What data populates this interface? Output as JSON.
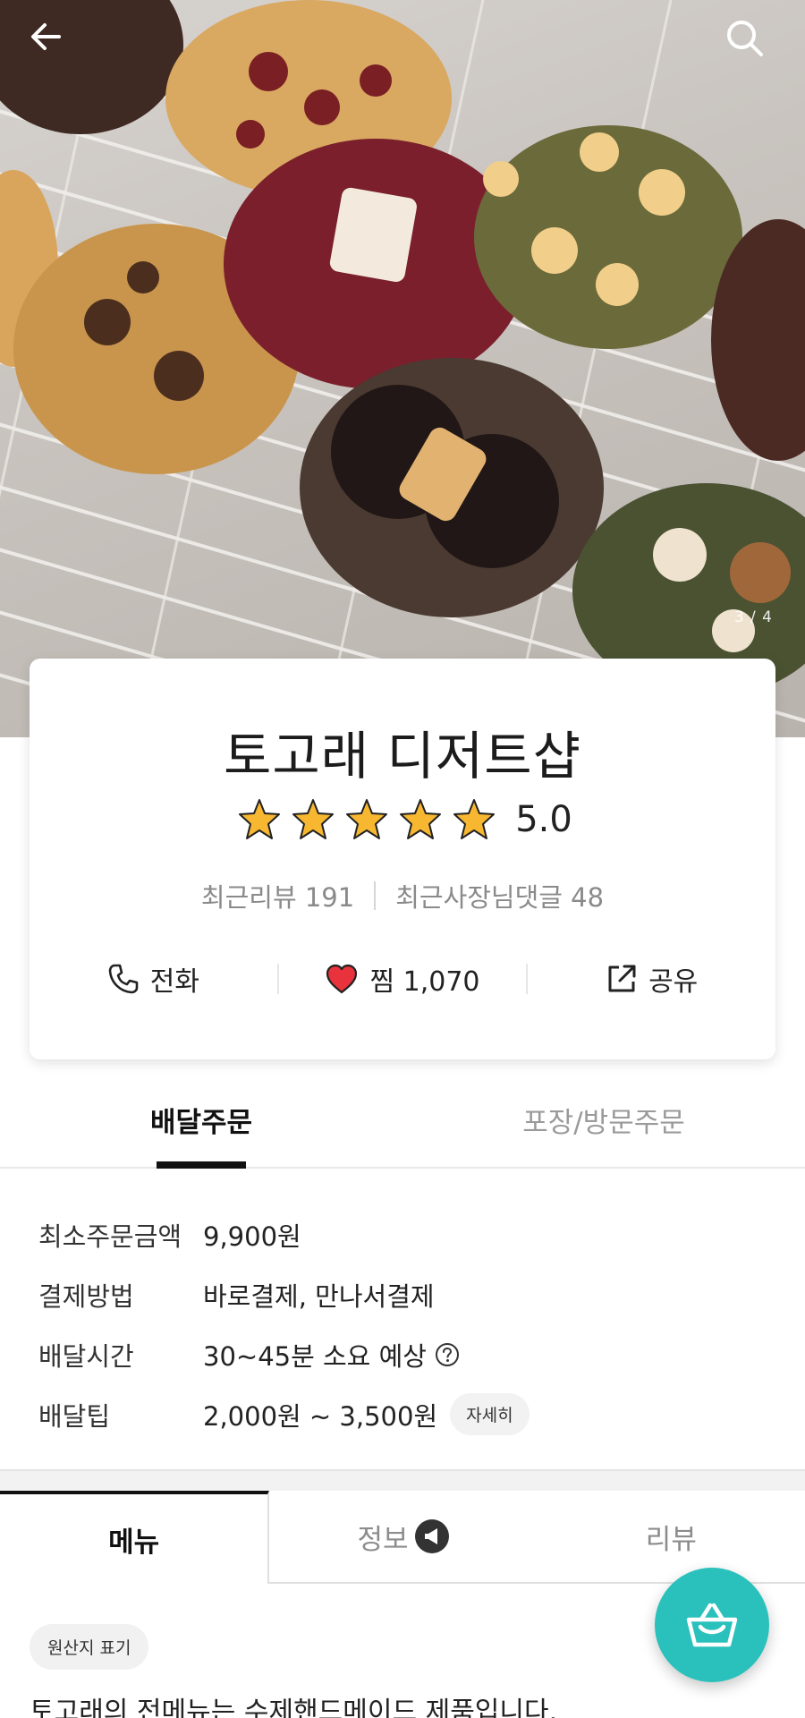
{
  "hero": {
    "image_counter": "3 / 4",
    "back_icon": "back-arrow-icon",
    "search_icon": "search-icon"
  },
  "store": {
    "name": "토고래 디저트샵",
    "rating": "5.0",
    "stars": 5,
    "recent_reviews": "최근리뷰 191",
    "owner_replies": "최근사장님댓글 48",
    "actions": {
      "call": "전화",
      "like": "찜 1,070",
      "share": "공유"
    }
  },
  "order_tabs": {
    "delivery": "배달주문",
    "pickup": "포장/방문주문"
  },
  "info": {
    "min_order_label": "최소주문금액",
    "min_order_value": "9,900원",
    "payment_label": "결제방법",
    "payment_value": "바로결제, 만나서결제",
    "time_label": "배달시간",
    "time_value": "30~45분 소요 예상",
    "tip_label": "배달팁",
    "tip_value": "2,000원 ~ 3,500원",
    "tip_detail_button": "자세히"
  },
  "menu_tabs": {
    "menu": "메뉴",
    "info": "정보",
    "review": "리뷰"
  },
  "origin_chip": "원산지 표기",
  "intro_text": "토고래의 전메뉴는 수제핸드메이드 제품입니다.",
  "colors": {
    "accent": "#2ac1bc",
    "star": "#f7b731",
    "heart": "#e8323c"
  }
}
